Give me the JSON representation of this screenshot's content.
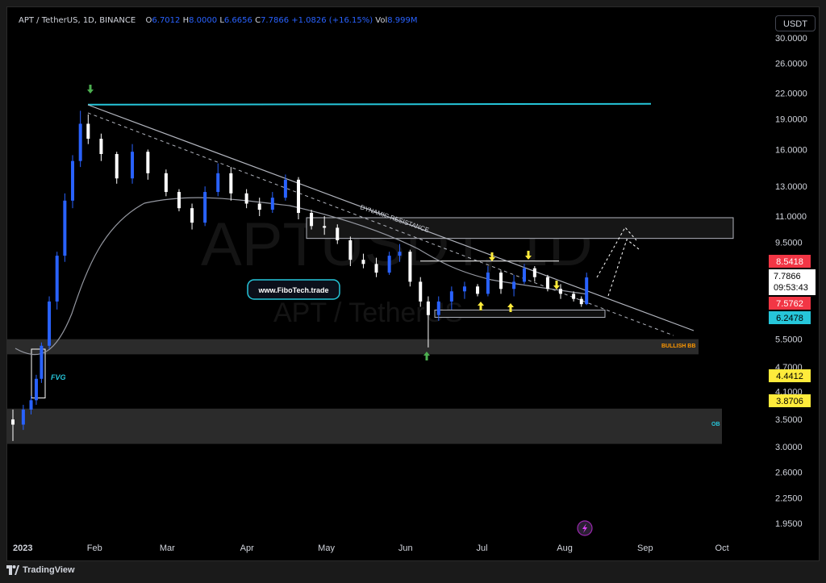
{
  "header": {
    "symbol": "APT / TetherUS, 1D, BINANCE",
    "o_label": "O",
    "o_value": "6.7012",
    "h_label": "H",
    "h_value": "8.0000",
    "l_label": "L",
    "l_value": "6.6656",
    "c_label": "C",
    "c_value": "7.7866",
    "change": "+1.0826 (+16.15%)",
    "vol_label": "Vol",
    "vol_value": "8.999M"
  },
  "currency_button": "USDT",
  "watermark": {
    "symbol": "APTUSDT, 1D",
    "name": "APT / TetherUS"
  },
  "annotations": {
    "dynamic_resistance": "DYNAMIC RESISTANCE",
    "website": "www.FiboTech.trade",
    "fvg": "FVG",
    "bullish_bb": "BULLISH BB",
    "ob": "OB"
  },
  "price_badges": {
    "red_high": "8.5418",
    "current": "7.7866",
    "countdown": "09:53:43",
    "red_low": "7.5762",
    "blue": "6.2478",
    "yellow_1": "4.4412",
    "yellow_2": "3.8706"
  },
  "colors": {
    "up": "#2962ff",
    "down": "#ffffff",
    "cyan_line": "#26c6da",
    "red_badge": "#f23645",
    "blue_badge": "#26c6da",
    "yellow_badge": "#ffeb3b",
    "green_arrow": "#4caf50",
    "yellow_arrow": "#ffeb3b",
    "bullish_bb_text": "#ff9800"
  },
  "footer": {
    "brand": "TradingView",
    "logo_icon": "tradingview-logo-icon"
  },
  "chart_data": {
    "type": "candlestick",
    "title": "APT / TetherUS, 1D, BINANCE",
    "xlabel": "",
    "ylabel": "",
    "y_scale": "log",
    "ylim": [
      1.75,
      33
    ],
    "x_ticks": [
      "2023",
      "Feb",
      "Mar",
      "Apr",
      "May",
      "Jun",
      "Jul",
      "Aug",
      "Sep",
      "Oct"
    ],
    "y_ticks": [
      "30.0000",
      "26.0000",
      "22.0000",
      "19.0000",
      "16.0000",
      "13.0000",
      "11.0000",
      "9.5000",
      "5.5000",
      "4.7000",
      "4.1000",
      "3.5000",
      "3.0000",
      "2.6000",
      "2.2500",
      "1.9500"
    ],
    "series": [
      {
        "type": "candlestick",
        "points": [
          [
            "2023-01-01",
            3.5,
            3.7,
            3.1,
            3.4
          ],
          [
            "2023-01-05",
            3.4,
            3.8,
            3.3,
            3.7
          ],
          [
            "2023-01-08",
            3.7,
            4.0,
            3.6,
            3.9
          ],
          [
            "2023-01-10",
            3.9,
            4.5,
            3.8,
            4.4
          ],
          [
            "2023-01-12",
            4.4,
            5.4,
            4.3,
            5.3
          ],
          [
            "2023-01-15",
            5.3,
            7.0,
            5.2,
            6.8
          ],
          [
            "2023-01-18",
            6.8,
            9.0,
            6.5,
            8.8
          ],
          [
            "2023-01-21",
            8.8,
            12.5,
            8.5,
            12.0
          ],
          [
            "2023-01-24",
            12.0,
            15.5,
            11.5,
            15.0
          ],
          [
            "2023-01-27",
            15.0,
            19.9,
            14.5,
            18.5
          ],
          [
            "2023-01-30",
            18.5,
            19.5,
            16.5,
            17.0
          ],
          [
            "2023-02-04",
            17.0,
            17.5,
            15.0,
            15.6
          ],
          [
            "2023-02-10",
            15.6,
            15.8,
            13.2,
            13.6
          ],
          [
            "2023-02-16",
            13.6,
            16.5,
            13.2,
            15.8
          ],
          [
            "2023-02-22",
            15.8,
            16.0,
            13.5,
            14.0
          ],
          [
            "2023-03-01",
            14.0,
            14.3,
            12.3,
            12.6
          ],
          [
            "2023-03-06",
            12.6,
            12.8,
            11.3,
            11.5
          ],
          [
            "2023-03-11",
            11.5,
            11.8,
            10.2,
            10.6
          ],
          [
            "2023-03-16",
            10.6,
            13.0,
            10.4,
            12.6
          ],
          [
            "2023-03-21",
            12.6,
            14.8,
            12.3,
            14.0
          ],
          [
            "2023-03-26",
            14.0,
            14.5,
            12.0,
            12.5
          ],
          [
            "2023-04-01",
            12.5,
            12.8,
            11.5,
            11.8
          ],
          [
            "2023-04-06",
            11.8,
            12.2,
            11.0,
            11.4
          ],
          [
            "2023-04-11",
            11.4,
            12.6,
            11.2,
            12.2
          ],
          [
            "2023-04-16",
            12.2,
            13.9,
            12.0,
            13.5
          ],
          [
            "2023-04-21",
            13.5,
            13.7,
            10.8,
            11.2
          ],
          [
            "2023-04-26",
            11.2,
            11.4,
            10.2,
            10.4
          ],
          [
            "2023-05-01",
            10.4,
            11.0,
            9.9,
            10.3
          ],
          [
            "2023-05-06",
            10.3,
            10.5,
            9.4,
            9.6
          ],
          [
            "2023-05-11",
            9.6,
            9.8,
            8.3,
            8.6
          ],
          [
            "2023-05-16",
            8.6,
            8.9,
            8.2,
            8.4
          ],
          [
            "2023-05-21",
            8.4,
            8.7,
            7.8,
            8.0
          ],
          [
            "2023-05-26",
            8.0,
            9.0,
            7.9,
            8.8
          ],
          [
            "2023-05-30",
            8.8,
            9.4,
            8.5,
            9.0
          ],
          [
            "2023-06-03",
            9.0,
            9.1,
            7.4,
            7.6
          ],
          [
            "2023-06-07",
            7.6,
            7.8,
            6.6,
            6.8
          ],
          [
            "2023-06-10",
            6.8,
            7.0,
            5.25,
            6.3
          ],
          [
            "2023-06-14",
            6.3,
            7.0,
            6.1,
            6.8
          ],
          [
            "2023-06-19",
            6.8,
            7.4,
            6.5,
            7.2
          ],
          [
            "2023-06-24",
            7.2,
            7.6,
            6.9,
            7.4
          ],
          [
            "2023-06-29",
            7.4,
            7.5,
            7.0,
            7.1
          ],
          [
            "2023-07-03",
            7.1,
            8.3,
            7.0,
            8.0
          ],
          [
            "2023-07-08",
            8.0,
            8.1,
            7.1,
            7.3
          ],
          [
            "2023-07-13",
            7.3,
            7.9,
            7.0,
            7.6
          ],
          [
            "2023-07-17",
            7.6,
            8.4,
            7.5,
            8.2
          ],
          [
            "2023-07-21",
            8.2,
            8.3,
            7.6,
            7.8
          ],
          [
            "2023-07-26",
            7.8,
            7.9,
            7.2,
            7.3
          ],
          [
            "2023-07-31",
            7.3,
            7.5,
            6.9,
            7.1
          ],
          [
            "2023-08-05",
            7.1,
            7.2,
            6.8,
            6.9
          ],
          [
            "2023-08-08",
            6.9,
            7.0,
            6.6,
            6.7
          ],
          [
            "2023-08-10",
            6.7012,
            8.0,
            6.6656,
            7.7866
          ]
        ]
      }
    ],
    "levels": {
      "cyan_resistance": 20.6,
      "white_box_top": 8.54,
      "upper_zone": [
        9.7,
        10.9
      ],
      "range_box": [
        6.22,
        6.48
      ],
      "bullish_bb_zone": [
        5.05,
        5.5
      ],
      "ob_zone": [
        3.05,
        3.72
      ],
      "fvg_box": [
        3.95,
        5.2
      ]
    }
  }
}
